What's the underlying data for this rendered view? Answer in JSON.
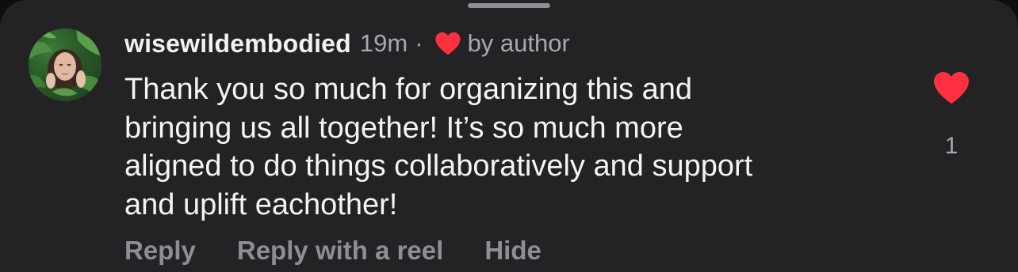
{
  "comment": {
    "username": "wisewildembodied",
    "time": "19m",
    "separator": "·",
    "author_badge": "by author",
    "text_lines": [
      "Thank you so much for organizing this and",
      "bringing us all together! It’s so much more",
      "aligned to do things collaboratively and support",
      "and uplift eachother!"
    ],
    "like_count": "1",
    "actions": {
      "reply": "Reply",
      "reply_with_reel": "Reply with a reel",
      "hide": "Hide"
    }
  },
  "icons": {
    "avatar": "profile-photo",
    "author_like": "heart-icon",
    "like": "heart-icon"
  },
  "colors": {
    "background": "#232326",
    "heart_red": "#ff3040",
    "text_primary": "#f4f4f4",
    "text_secondary": "#a8a8ad",
    "action_text": "#8e8e93"
  }
}
